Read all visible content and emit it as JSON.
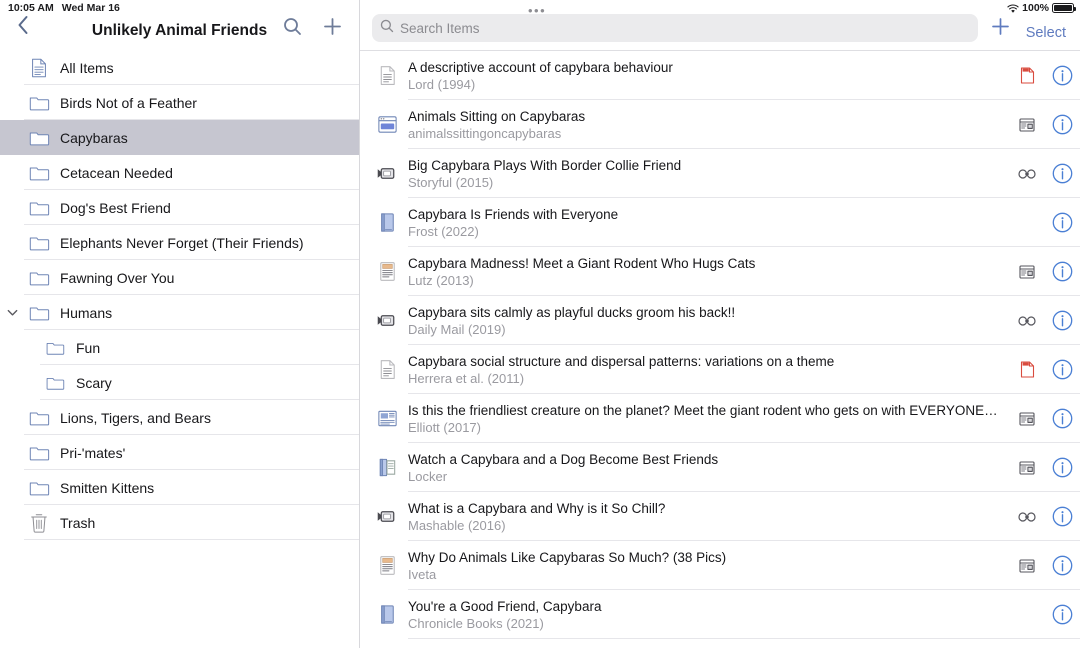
{
  "statusbar": {
    "time": "10:05 AM",
    "date": "Wed Mar 16",
    "wifi_icon": "wifi-icon",
    "battery_percent": "100%",
    "battery_icon": "battery-icon"
  },
  "pane_handle": "•••",
  "sidebar": {
    "back_icon": "chevron-left-icon",
    "title": "Unlikely Animal Friends",
    "search_icon": "search-icon",
    "add_icon": "plus-icon",
    "items": [
      {
        "label": "All Items",
        "icon": "all-items-icon",
        "indent": 0,
        "selected": false,
        "disclosure": ""
      },
      {
        "label": "Birds Not of a Feather",
        "icon": "folder-icon",
        "indent": 0,
        "selected": false,
        "disclosure": ""
      },
      {
        "label": "Capybaras",
        "icon": "folder-icon",
        "indent": 0,
        "selected": true,
        "disclosure": ""
      },
      {
        "label": "Cetacean Needed",
        "icon": "folder-icon",
        "indent": 0,
        "selected": false,
        "disclosure": ""
      },
      {
        "label": "Dog's Best Friend",
        "icon": "folder-icon",
        "indent": 0,
        "selected": false,
        "disclosure": ""
      },
      {
        "label": "Elephants Never Forget (Their Friends)",
        "icon": "folder-icon",
        "indent": 0,
        "selected": false,
        "disclosure": ""
      },
      {
        "label": "Fawning Over You",
        "icon": "folder-icon",
        "indent": 0,
        "selected": false,
        "disclosure": ""
      },
      {
        "label": "Humans",
        "icon": "folder-icon",
        "indent": 0,
        "selected": false,
        "disclosure": "chevron-down-icon"
      },
      {
        "label": "Fun",
        "icon": "folder-icon",
        "indent": 1,
        "selected": false,
        "disclosure": ""
      },
      {
        "label": "Scary",
        "icon": "folder-icon",
        "indent": 1,
        "selected": false,
        "disclosure": ""
      },
      {
        "label": "Lions, Tigers, and Bears",
        "icon": "folder-icon",
        "indent": 0,
        "selected": false,
        "disclosure": ""
      },
      {
        "label": "Pri-'mates'",
        "icon": "folder-icon",
        "indent": 0,
        "selected": false,
        "disclosure": ""
      },
      {
        "label": "Smitten Kittens",
        "icon": "folder-icon",
        "indent": 0,
        "selected": false,
        "disclosure": ""
      },
      {
        "label": "Trash",
        "icon": "trash-icon",
        "indent": 0,
        "selected": false,
        "disclosure": ""
      }
    ]
  },
  "items_pane": {
    "search": {
      "icon": "search-icon",
      "placeholder": "Search Items",
      "value": ""
    },
    "add_icon": "plus-icon",
    "select_label": "Select",
    "rows": [
      {
        "title": "A descriptive account of capybara behaviour",
        "subtitle": "Lord (1994)",
        "type_icon": "document-icon",
        "attachment_icon": "pdf-attachment-icon",
        "info_icon": "info-circle-icon"
      },
      {
        "title": "Animals Sitting on Capybaras",
        "subtitle": "animalssittingoncapybaras",
        "type_icon": "webpage-icon",
        "attachment_icon": "snapshot-attachment-icon",
        "info_icon": "info-circle-icon"
      },
      {
        "title": "Big Capybara Plays With Border Collie Friend",
        "subtitle": "Storyful (2015)",
        "type_icon": "video-icon",
        "attachment_icon": "link-attachment-icon",
        "info_icon": "info-circle-icon"
      },
      {
        "title": "Capybara Is Friends with Everyone",
        "subtitle": "Frost (2022)",
        "type_icon": "book-icon",
        "attachment_icon": "",
        "info_icon": "info-circle-icon"
      },
      {
        "title": "Capybara Madness! Meet a Giant Rodent Who Hugs Cats",
        "subtitle": "Lutz (2013)",
        "type_icon": "magazine-article-icon",
        "attachment_icon": "snapshot-attachment-icon",
        "info_icon": "info-circle-icon"
      },
      {
        "title": "Capybara sits calmly as playful ducks groom his back!!",
        "subtitle": "Daily Mail (2019)",
        "type_icon": "video-icon",
        "attachment_icon": "link-attachment-icon",
        "info_icon": "info-circle-icon"
      },
      {
        "title": "Capybara social structure and dispersal patterns: variations on a theme",
        "subtitle": "Herrera et al. (2011)",
        "type_icon": "document-icon",
        "attachment_icon": "pdf-attachment-icon",
        "info_icon": "info-circle-icon"
      },
      {
        "title": "Is this the friendliest creature on the planet? Meet the giant rodent who gets on with EVERYONE…",
        "subtitle": "Elliott (2017)",
        "type_icon": "newspaper-article-icon",
        "attachment_icon": "snapshot-attachment-icon",
        "info_icon": "info-circle-icon"
      },
      {
        "title": "Watch a Capybara and a Dog Become Best Friends",
        "subtitle": "Locker",
        "type_icon": "book-section-icon",
        "attachment_icon": "snapshot-attachment-icon",
        "info_icon": "info-circle-icon"
      },
      {
        "title": "What is a Capybara and Why is it So Chill?",
        "subtitle": "Mashable (2016)",
        "type_icon": "video-icon",
        "attachment_icon": "link-attachment-icon",
        "info_icon": "info-circle-icon"
      },
      {
        "title": "Why Do Animals Like Capybaras So Much? (38 Pics)",
        "subtitle": "Iveta",
        "type_icon": "magazine-article-icon",
        "attachment_icon": "snapshot-attachment-icon",
        "info_icon": "info-circle-icon"
      },
      {
        "title": "You're a Good Friend, Capybara",
        "subtitle": "Chronicle Books (2021)",
        "type_icon": "book-icon",
        "attachment_icon": "",
        "info_icon": "info-circle-icon"
      }
    ]
  },
  "colors": {
    "accent_blue": "#5f7bbf",
    "info_blue": "#4a7fd4",
    "selected_row": "#c6c6d0",
    "pdf_red": "#d94b3e",
    "separator": "#e6e6ea"
  }
}
